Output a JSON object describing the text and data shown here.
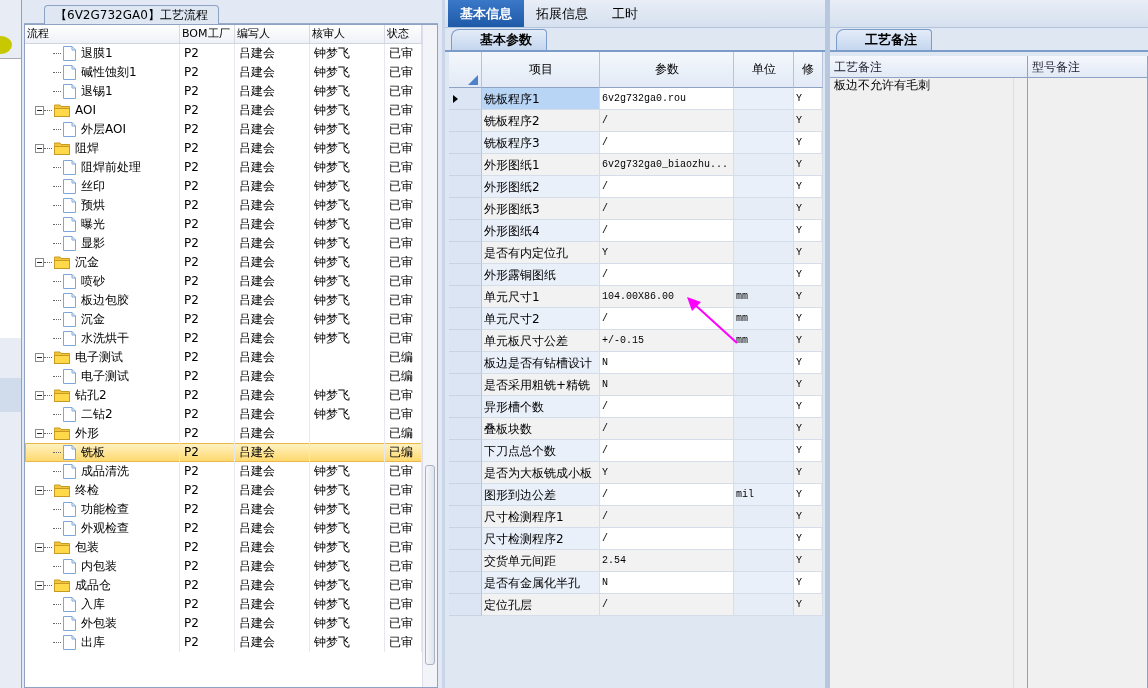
{
  "tree": {
    "title": "【6V2G732GA0】工艺流程",
    "columns": [
      "流程",
      "BOM工厂",
      "编写人",
      "核审人",
      "状态"
    ],
    "rows": [
      {
        "kind": "continuation",
        "children": [
          {
            "kind": "file",
            "name": "退膜1",
            "bom": "P2",
            "writer": "吕建会",
            "reviewer": "钟梦飞",
            "status": "已审",
            "selected": false
          },
          {
            "kind": "file",
            "name": "碱性蚀刻1",
            "bom": "P2",
            "writer": "吕建会",
            "reviewer": "钟梦飞",
            "status": "已审",
            "selected": false
          },
          {
            "kind": "file",
            "name": "退锡1",
            "bom": "P2",
            "writer": "吕建会",
            "reviewer": "钟梦飞",
            "status": "已审",
            "selected": false
          }
        ]
      },
      {
        "kind": "folder",
        "name": "AOI",
        "bom": "P2",
        "writer": "吕建会",
        "reviewer": "钟梦飞",
        "status": "已审",
        "selected": false,
        "expanded": true,
        "children": [
          {
            "kind": "file",
            "name": "外层AOI",
            "bom": "P2",
            "writer": "吕建会",
            "reviewer": "钟梦飞",
            "status": "已审",
            "selected": false
          }
        ]
      },
      {
        "kind": "folder",
        "name": "阻焊",
        "bom": "P2",
        "writer": "吕建会",
        "reviewer": "钟梦飞",
        "status": "已审",
        "selected": false,
        "expanded": true,
        "children": [
          {
            "kind": "file",
            "name": "阻焊前处理",
            "bom": "P2",
            "writer": "吕建会",
            "reviewer": "钟梦飞",
            "status": "已审",
            "selected": false
          },
          {
            "kind": "file",
            "name": "丝印",
            "bom": "P2",
            "writer": "吕建会",
            "reviewer": "钟梦飞",
            "status": "已审",
            "selected": false
          },
          {
            "kind": "file",
            "name": "预烘",
            "bom": "P2",
            "writer": "吕建会",
            "reviewer": "钟梦飞",
            "status": "已审",
            "selected": false
          },
          {
            "kind": "file",
            "name": "曝光",
            "bom": "P2",
            "writer": "吕建会",
            "reviewer": "钟梦飞",
            "status": "已审",
            "selected": false
          },
          {
            "kind": "file",
            "name": "显影",
            "bom": "P2",
            "writer": "吕建会",
            "reviewer": "钟梦飞",
            "status": "已审",
            "selected": false
          }
        ]
      },
      {
        "kind": "folder",
        "name": "沉金",
        "bom": "P2",
        "writer": "吕建会",
        "reviewer": "钟梦飞",
        "status": "已审",
        "selected": false,
        "expanded": true,
        "children": [
          {
            "kind": "file",
            "name": "喷砂",
            "bom": "P2",
            "writer": "吕建会",
            "reviewer": "钟梦飞",
            "status": "已审",
            "selected": false
          },
          {
            "kind": "file",
            "name": "板边包胶",
            "bom": "P2",
            "writer": "吕建会",
            "reviewer": "钟梦飞",
            "status": "已审",
            "selected": false
          },
          {
            "kind": "file",
            "name": "沉金",
            "bom": "P2",
            "writer": "吕建会",
            "reviewer": "钟梦飞",
            "status": "已审",
            "selected": false
          },
          {
            "kind": "file",
            "name": "水洗烘干",
            "bom": "P2",
            "writer": "吕建会",
            "reviewer": "钟梦飞",
            "status": "已审",
            "selected": false
          }
        ]
      },
      {
        "kind": "folder",
        "name": "电子测试",
        "bom": "P2",
        "writer": "吕建会",
        "status": "已编",
        "selected": false,
        "expanded": true,
        "children": [
          {
            "kind": "file",
            "name": "电子测试",
            "bom": "P2",
            "writer": "吕建会",
            "status": "已编",
            "selected": false
          }
        ]
      },
      {
        "kind": "folder",
        "name": "钻孔2",
        "bom": "P2",
        "writer": "吕建会",
        "reviewer": "钟梦飞",
        "status": "已审",
        "selected": false,
        "expanded": true,
        "children": [
          {
            "kind": "file",
            "name": "二钻2",
            "bom": "P2",
            "writer": "吕建会",
            "reviewer": "钟梦飞",
            "status": "已审",
            "selected": false
          }
        ]
      },
      {
        "kind": "folder",
        "name": "外形",
        "bom": "P2",
        "writer": "吕建会",
        "status": "已编",
        "selected": false,
        "expanded": true,
        "children": [
          {
            "kind": "file",
            "name": "铣板",
            "bom": "P2",
            "writer": "吕建会",
            "status": "已编",
            "selected": true
          },
          {
            "kind": "file",
            "name": "成品清洗",
            "bom": "P2",
            "writer": "吕建会",
            "reviewer": "钟梦飞",
            "status": "已审",
            "selected": false
          }
        ]
      },
      {
        "kind": "folder",
        "name": "终检",
        "bom": "P2",
        "writer": "吕建会",
        "reviewer": "钟梦飞",
        "status": "已审",
        "selected": false,
        "expanded": true,
        "children": [
          {
            "kind": "file",
            "name": "功能检查",
            "bom": "P2",
            "writer": "吕建会",
            "reviewer": "钟梦飞",
            "status": "已审",
            "selected": false
          },
          {
            "kind": "file",
            "name": "外观检查",
            "bom": "P2",
            "writer": "吕建会",
            "reviewer": "钟梦飞",
            "status": "已审",
            "selected": false
          }
        ]
      },
      {
        "kind": "folder",
        "name": "包装",
        "bom": "P2",
        "writer": "吕建会",
        "reviewer": "钟梦飞",
        "status": "已审",
        "selected": false,
        "expanded": true,
        "children": [
          {
            "kind": "file",
            "name": "内包装",
            "bom": "P2",
            "writer": "吕建会",
            "reviewer": "钟梦飞",
            "status": "已审",
            "selected": false
          }
        ]
      },
      {
        "kind": "folder",
        "name": "成品仓",
        "bom": "P2",
        "writer": "吕建会",
        "reviewer": "钟梦飞",
        "status": "已审",
        "selected": false,
        "expanded": true,
        "children": [
          {
            "kind": "file",
            "name": "入库",
            "bom": "P2",
            "writer": "吕建会",
            "reviewer": "钟梦飞",
            "status": "已审",
            "selected": false
          },
          {
            "kind": "file",
            "name": "外包装",
            "bom": "P2",
            "writer": "吕建会",
            "reviewer": "钟梦飞",
            "status": "已审",
            "selected": false
          },
          {
            "kind": "file",
            "name": "出库",
            "bom": "P2",
            "writer": "吕建会",
            "reviewer": "钟梦飞",
            "status": "已审",
            "selected": false
          }
        ]
      }
    ]
  },
  "tabs": [
    {
      "label": "基本信息",
      "selected": true
    },
    {
      "label": "拓展信息",
      "selected": false
    },
    {
      "label": "工时",
      "selected": false
    }
  ],
  "params": {
    "tab": "基本参数",
    "columns": [
      "项目",
      "参数",
      "单位",
      "修"
    ],
    "rows": [
      {
        "item": "铣板程序1",
        "value": "6v2g732ga0.rou",
        "flag": "Y",
        "selected": true
      },
      {
        "item": "铣板程序2",
        "value": "/",
        "flag": "Y",
        "selected": false
      },
      {
        "item": "铣板程序3",
        "value": "/",
        "flag": "Y",
        "selected": false
      },
      {
        "item": "外形图纸1",
        "value": "6v2g732ga0_biaozhu...",
        "flag": "Y",
        "selected": false
      },
      {
        "item": "外形图纸2",
        "value": "/",
        "flag": "Y",
        "selected": false
      },
      {
        "item": "外形图纸3",
        "value": "/",
        "flag": "Y",
        "selected": false
      },
      {
        "item": "外形图纸4",
        "value": "/",
        "flag": "Y",
        "selected": false
      },
      {
        "item": "是否有内定位孔",
        "value": "Y",
        "flag": "Y",
        "selected": false
      },
      {
        "item": "外形露铜图纸",
        "value": "/",
        "flag": "Y",
        "selected": false
      },
      {
        "item": "单元尺寸1",
        "value": "104.00X86.00",
        "unit": "mm",
        "flag": "Y",
        "selected": false
      },
      {
        "item": "单元尺寸2",
        "value": "/",
        "unit": "mm",
        "flag": "Y",
        "selected": false
      },
      {
        "item": "单元板尺寸公差",
        "value": "+/-0.15",
        "unit": "mm",
        "flag": "Y",
        "selected": false
      },
      {
        "item": "板边是否有钻槽设计",
        "value": "N",
        "flag": "Y",
        "selected": false
      },
      {
        "item": "是否采用粗铣+精铣",
        "value": "N",
        "flag": "Y",
        "selected": false
      },
      {
        "item": "异形槽个数",
        "value": "/",
        "flag": "Y",
        "selected": false
      },
      {
        "item": "叠板块数",
        "value": "/",
        "flag": "Y",
        "selected": false
      },
      {
        "item": "下刀点总个数",
        "value": "/",
        "flag": "Y",
        "selected": false
      },
      {
        "item": "是否为大板铣成小板",
        "value": "Y",
        "flag": "Y",
        "selected": false
      },
      {
        "item": "图形到边公差",
        "value": "/",
        "unit": "mil",
        "flag": "Y",
        "selected": false
      },
      {
        "item": "尺寸检测程序1",
        "value": "/",
        "flag": "Y",
        "selected": false
      },
      {
        "item": "尺寸检测程序2",
        "value": "/",
        "flag": "Y",
        "selected": false
      },
      {
        "item": "交货单元间距",
        "value": "2.54",
        "flag": "Y",
        "selected": false
      },
      {
        "item": "是否有金属化半孔",
        "value": "N",
        "flag": "Y",
        "selected": false
      },
      {
        "item": "定位孔层",
        "value": "/",
        "flag": "Y",
        "selected": false
      }
    ]
  },
  "annotations": [
    {
      "kind": "arrow"
    }
  ],
  "notes": {
    "tab": "工艺备注",
    "columns": [
      "工艺备注",
      "型号备注"
    ],
    "process_note": "板边不允许有毛刺"
  }
}
